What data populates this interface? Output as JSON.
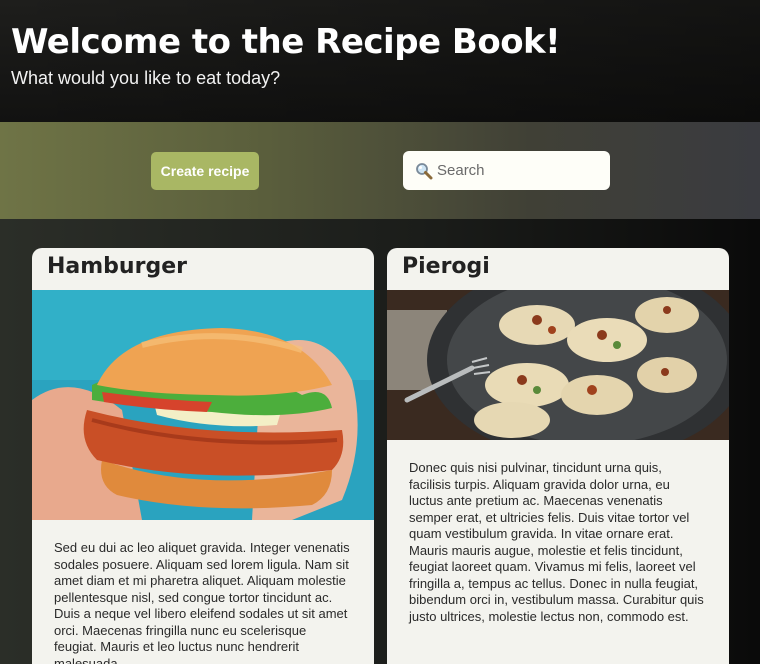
{
  "header": {
    "title": "Welcome to the Recipe Book!",
    "subtitle": "What would you like to eat today?"
  },
  "toolbar": {
    "create_label": "Create recipe",
    "search_placeholder": "Search",
    "search_icon": "magnifier-icon"
  },
  "recipes": [
    {
      "title": "Hamburger",
      "image": "hamburger-photo",
      "description": "Sed eu dui ac leo aliquet gravida. Integer venenatis sodales posuere. Aliquam sed lorem ligula. Nam sit amet diam et mi pharetra aliquet. Aliquam molestie pellentesque nisl, sed congue tortor tincidunt ac. Duis a neque vel libero eleifend sodales ut sit amet orci. Maecenas fringilla nunc eu scelerisque feugiat. Mauris et leo luctus nunc hendrerit malesuada."
    },
    {
      "title": "Pierogi",
      "image": "pierogi-photo",
      "description": "Donec quis nisi pulvinar, tincidunt urna quis, facilisis turpis. Aliquam gravida dolor urna, eu luctus ante pretium ac. Maecenas venenatis semper erat, et ultricies felis. Duis vitae tortor vel quam vestibulum gravida. In vitae ornare erat. Mauris mauris augue, molestie et felis tincidunt, feugiat laoreet quam. Vivamus mi felis, laoreet vel fringilla a, tempus ac tellus. Donec in nulla feugiat, bibendum orci in, vestibulum massa. Curabitur quis justo ultrices, molestie lectus non, commodo est."
    }
  ]
}
